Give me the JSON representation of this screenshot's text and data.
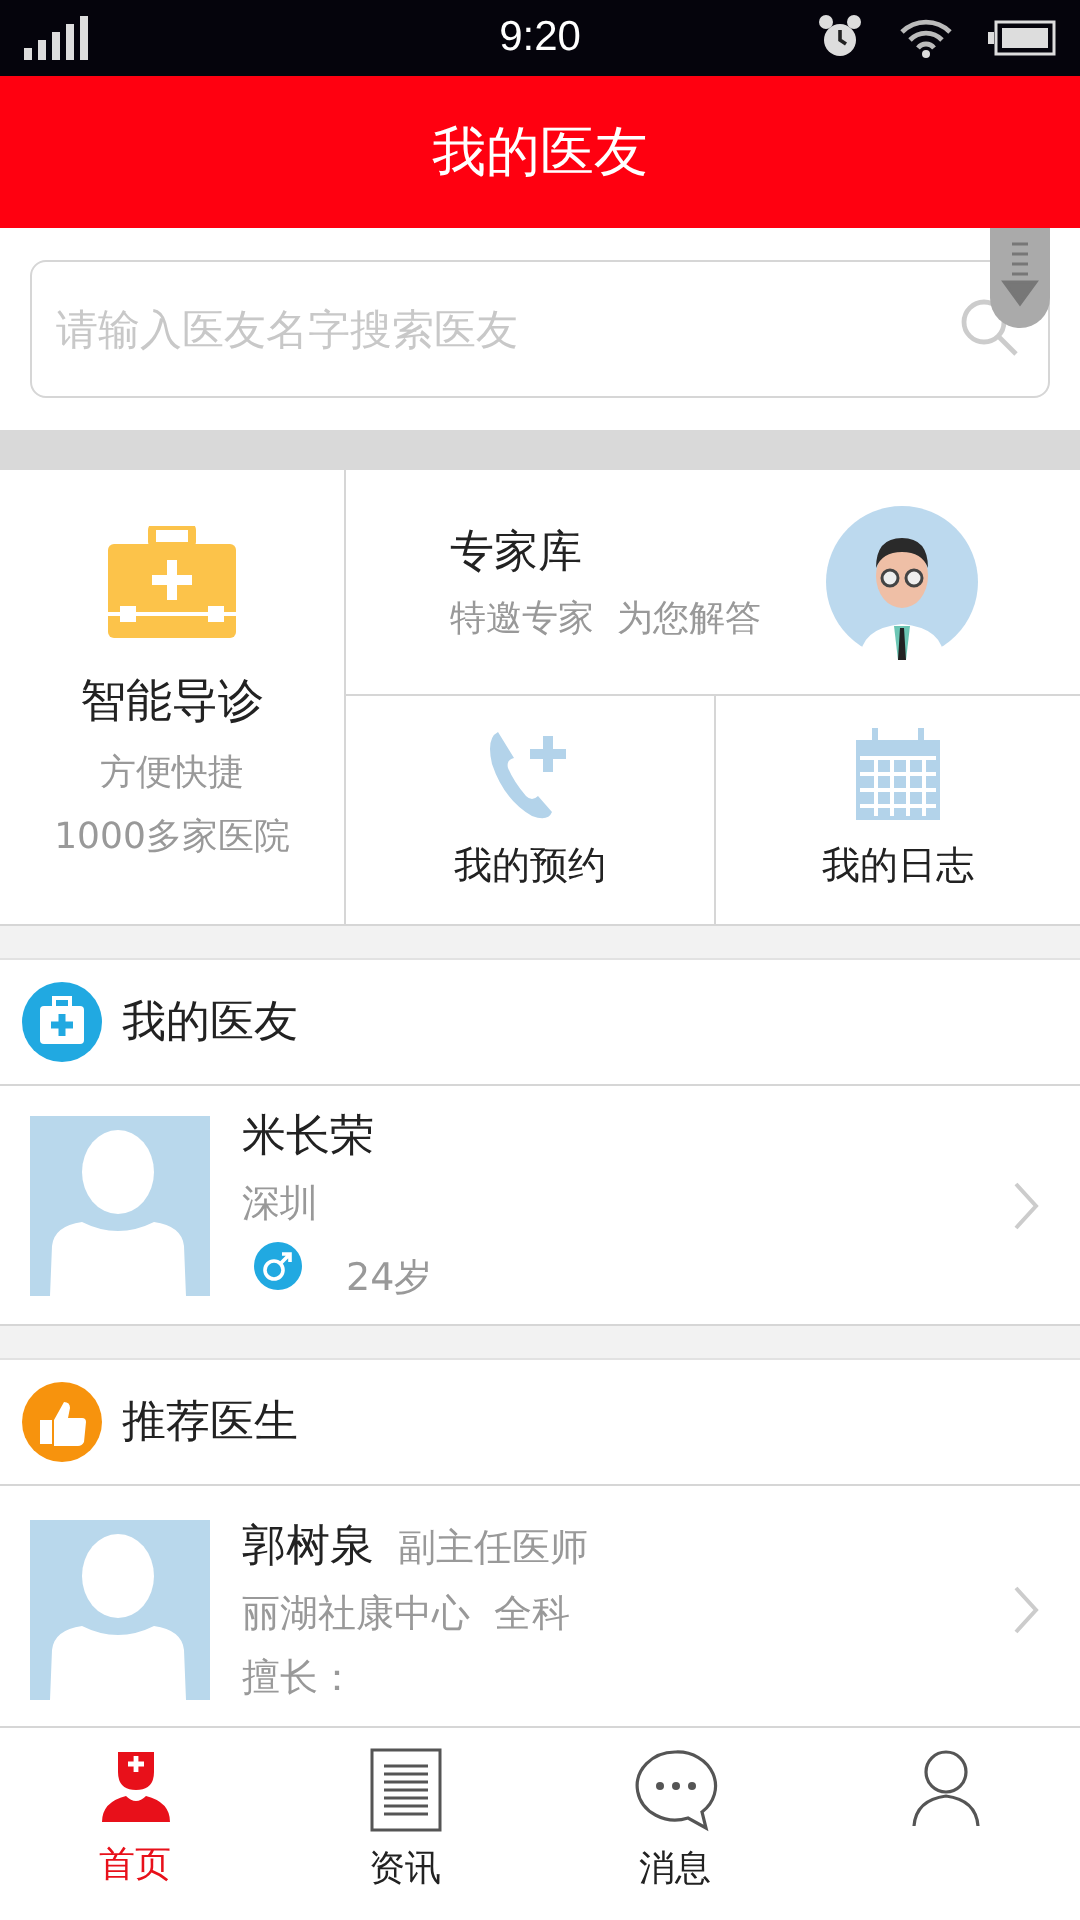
{
  "status_bar": {
    "time": "9:20"
  },
  "header": {
    "title": "我的医友"
  },
  "search": {
    "placeholder": "请输入医友名字搜索医友"
  },
  "features": {
    "guide": {
      "title": "智能导诊",
      "lines": [
        "方便快捷",
        "1000多家医院"
      ]
    },
    "experts": {
      "title": "专家库",
      "subtitle": "特邀专家  为您解答"
    },
    "shortcuts": [
      {
        "kind": "appointment",
        "label": "我的预约"
      },
      {
        "kind": "diary",
        "label": "我的日志"
      }
    ]
  },
  "my_friends": {
    "title": "我的医友",
    "items": [
      {
        "name": "米长荣",
        "city": "深圳",
        "kind": "male",
        "age": "24岁"
      }
    ]
  },
  "recommended": {
    "title": "推荐医生",
    "items": [
      {
        "name": "郭树泉",
        "rank": "副主任医师",
        "hospital": "丽湖社康中心",
        "department": "全科",
        "specialty": "擅长："
      }
    ]
  },
  "tab_bar": [
    {
      "kind": "home",
      "label": "首页",
      "selected": true
    },
    {
      "kind": "news",
      "label": "资讯",
      "selected": false
    },
    {
      "kind": "messages",
      "label": "消息",
      "selected": false
    },
    {
      "kind": "profile",
      "selected": false
    }
  ]
}
